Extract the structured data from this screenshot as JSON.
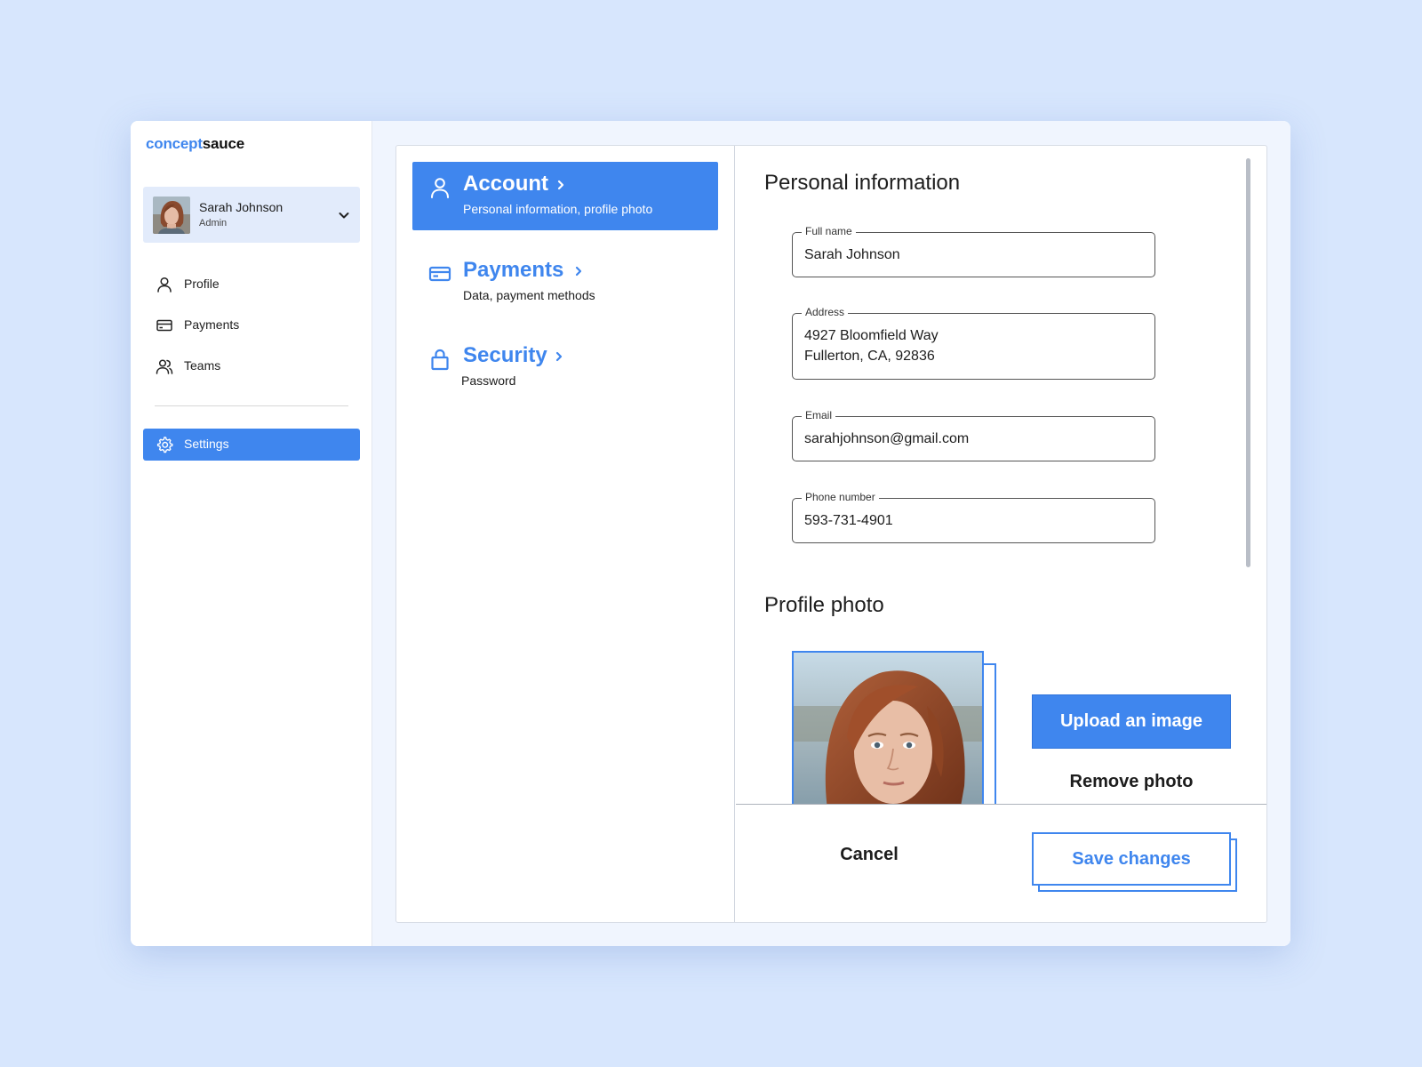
{
  "brand": {
    "part1": "concept",
    "part2": "sauce"
  },
  "user": {
    "name": "Sarah Johnson",
    "role": "Admin"
  },
  "sidebar": {
    "items": [
      {
        "label": "Profile",
        "icon": "user-icon"
      },
      {
        "label": "Payments",
        "icon": "credit-card-icon"
      },
      {
        "label": "Teams",
        "icon": "users-icon"
      }
    ],
    "settings": {
      "label": "Settings",
      "icon": "gear-icon",
      "active": true
    }
  },
  "categories": [
    {
      "title": "Account",
      "subtitle": "Personal information, profile photo",
      "icon": "user-icon",
      "active": true
    },
    {
      "title": "Payments",
      "subtitle": "Data, payment methods",
      "icon": "credit-card-icon",
      "active": false
    },
    {
      "title": "Security",
      "subtitle": "Password",
      "icon": "lock-icon",
      "active": false
    }
  ],
  "personal": {
    "title": "Personal information",
    "full_name": {
      "label": "Full name",
      "value": "Sarah Johnson"
    },
    "address": {
      "label": "Address",
      "line1": "4927 Bloomfield Way",
      "line2": "Fullerton, CA, 92836"
    },
    "email": {
      "label": "Email",
      "value": "sarahjohnson@gmail.com"
    },
    "phone": {
      "label": "Phone number",
      "value": "593-731-4901"
    }
  },
  "photo": {
    "title": "Profile photo",
    "upload_label": "Upload an image",
    "remove_label": "Remove photo"
  },
  "footer": {
    "cancel_label": "Cancel",
    "save_label": "Save changes"
  },
  "colors": {
    "accent": "#3f86ee",
    "background": "#d7e6fd",
    "panel": "#f0f5fe"
  }
}
